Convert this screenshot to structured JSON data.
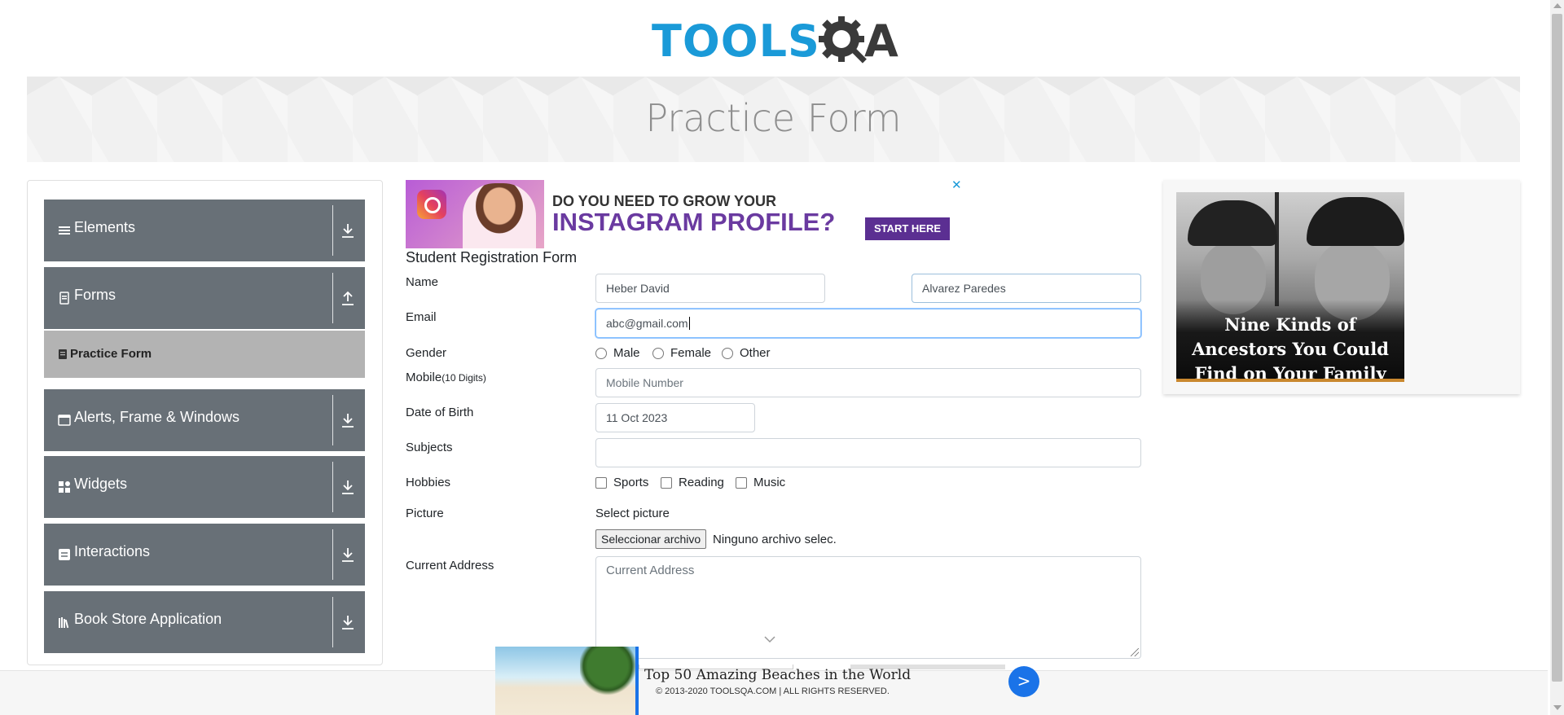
{
  "header": {
    "logo_tools": "TOOLS",
    "logo_a": "A",
    "banner_title": "Practice Form"
  },
  "sidebar": {
    "groups": [
      {
        "label": "Elements",
        "icon": "hamburger-icon",
        "arrow": "download-arrow-icon"
      },
      {
        "label": "Forms",
        "icon": "form-document-icon",
        "arrow": "upload-arrow-icon"
      },
      {
        "label": "Alerts, Frame & Windows",
        "icon": "window-icon",
        "arrow": "download-arrow-icon"
      },
      {
        "label": "Widgets",
        "icon": "widgets-grid-icon",
        "arrow": "download-arrow-icon"
      },
      {
        "label": "Interactions",
        "icon": "interactions-icon",
        "arrow": "download-arrow-icon"
      },
      {
        "label": "Book Store Application",
        "icon": "books-icon",
        "arrow": "download-arrow-icon"
      }
    ],
    "active_item": "Practice Form"
  },
  "ad_top": {
    "line1": "DO YOU NEED TO GROW YOUR",
    "line2": "INSTAGRAM PROFILE?",
    "cta": "START HERE",
    "close": "✕"
  },
  "form": {
    "title": "Student Registration Form",
    "name_label": "Name",
    "first_name_value": "Heber David",
    "last_name_value": "Alvarez Paredes",
    "email_label": "Email",
    "email_value": "abc@gmail.com",
    "gender_label": "Gender",
    "gender_options": [
      "Male",
      "Female",
      "Other"
    ],
    "mobile_label": "Mobile",
    "mobile_hint": "(10 Digits)",
    "mobile_placeholder": "Mobile Number",
    "dob_label": "Date of Birth",
    "dob_value": "11 Oct 2023",
    "subjects_label": "Subjects",
    "hobbies_label": "Hobbies",
    "hobbies_options": [
      "Sports",
      "Reading",
      "Music"
    ],
    "picture_label": "Picture",
    "select_picture_label": "Select picture",
    "file_button": "Seleccionar archivo",
    "file_status": "Ninguno archivo selec.",
    "address_label": "Current Address",
    "address_placeholder": "Current Address"
  },
  "ad_right": {
    "caption": "Nine Kinds of Ancestors You Could Find on Your Family Tree"
  },
  "footer": {
    "copyright": "© 2013-2020 TOOLSQA.COM | ALL RIGHTS RESERVED."
  },
  "ad_bottom": {
    "title": "Top 50 Amazing Beaches in the World",
    "next": ">"
  },
  "colors": {
    "sidebar_bg": "#687077",
    "active_item_bg": "#b3b3b3",
    "logo_blue": "#1a9ad8",
    "accent_blue": "#1a73e8"
  }
}
